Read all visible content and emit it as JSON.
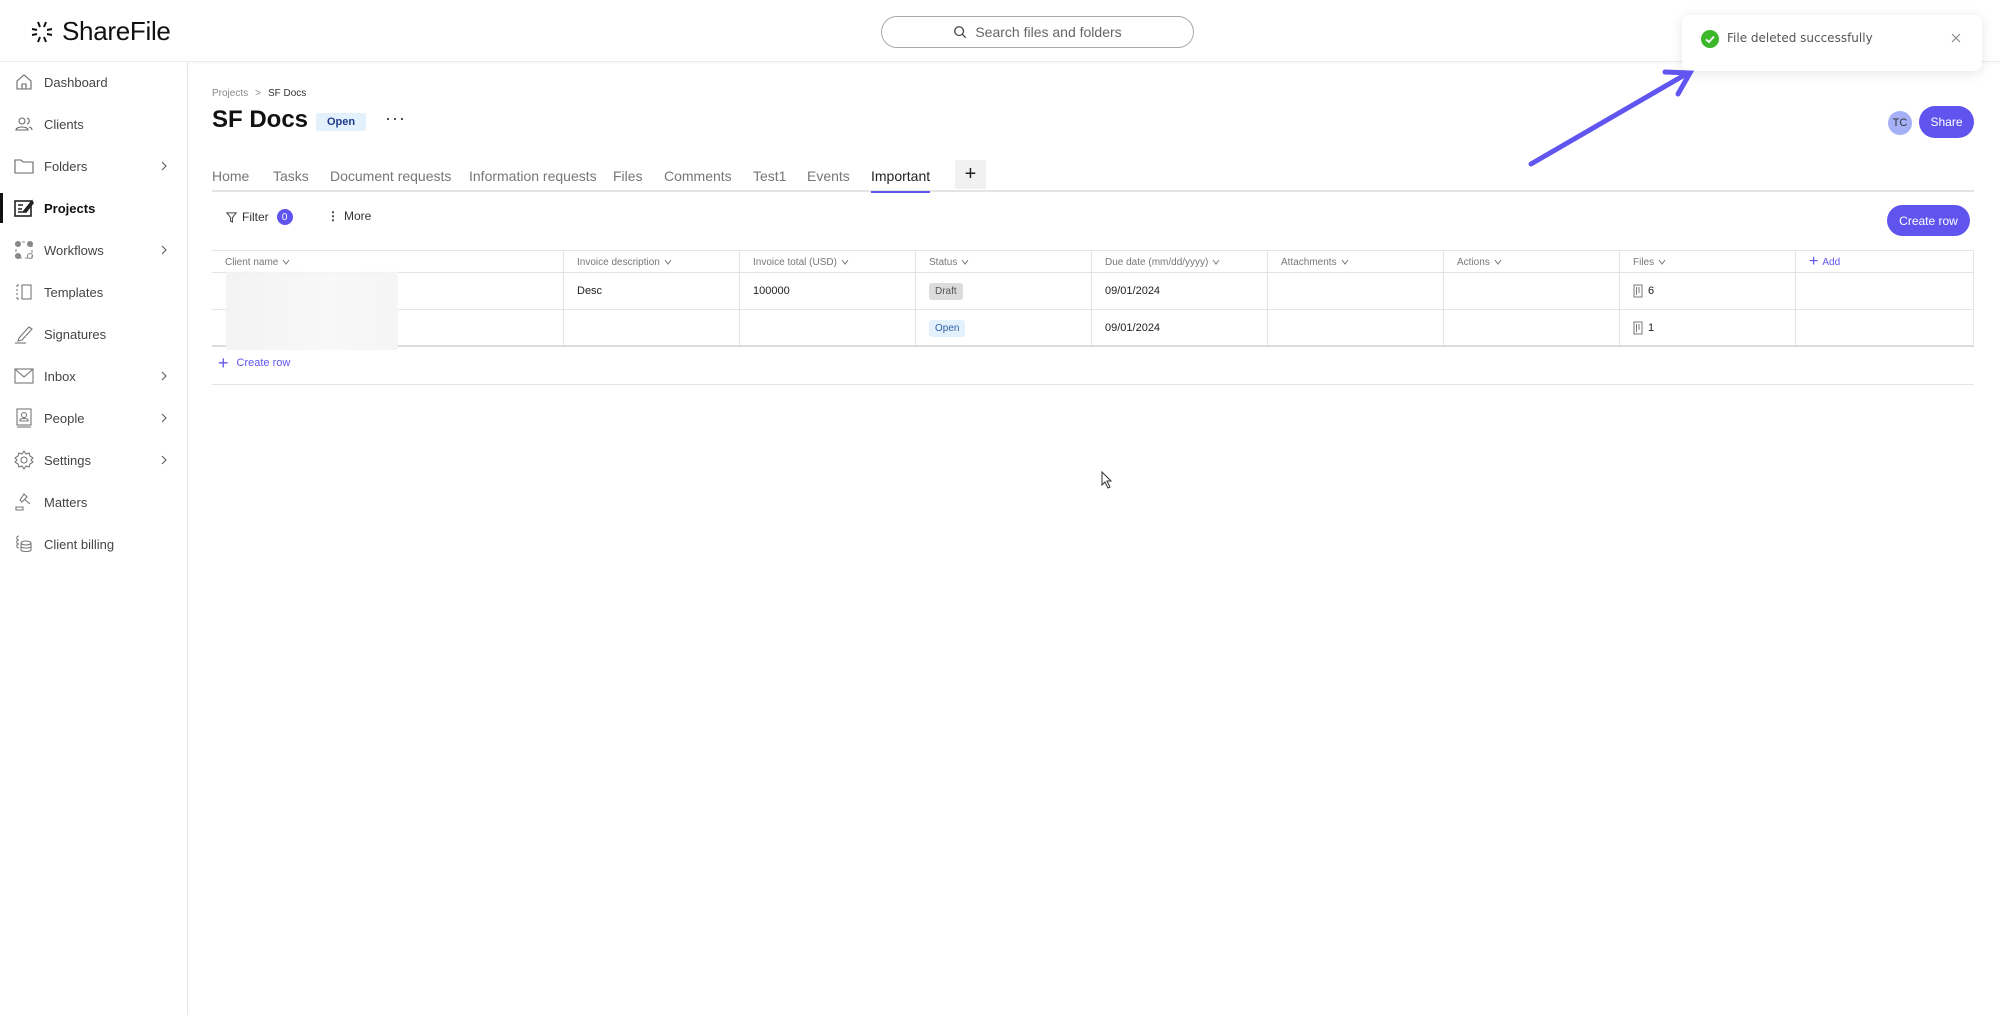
{
  "app": {
    "logo_text": "ShareFile"
  },
  "search": {
    "placeholder": "Search files and folders"
  },
  "sidebar": {
    "items": [
      {
        "label": "Dashboard",
        "icon": "home-icon",
        "has_chevron": false,
        "active": false
      },
      {
        "label": "Clients",
        "icon": "people-icon",
        "has_chevron": false,
        "active": false
      },
      {
        "label": "Folders",
        "icon": "folder-icon",
        "has_chevron": true,
        "active": false
      },
      {
        "label": "Projects",
        "icon": "projects-icon",
        "has_chevron": false,
        "active": true
      },
      {
        "label": "Workflows",
        "icon": "workflows-icon",
        "has_chevron": true,
        "active": false
      },
      {
        "label": "Templates",
        "icon": "templates-icon",
        "has_chevron": false,
        "active": false
      },
      {
        "label": "Signatures",
        "icon": "pen-icon",
        "has_chevron": false,
        "active": false
      },
      {
        "label": "Inbox",
        "icon": "mail-icon",
        "has_chevron": true,
        "active": false
      },
      {
        "label": "People",
        "icon": "contact-book-icon",
        "has_chevron": true,
        "active": false
      },
      {
        "label": "Settings",
        "icon": "gear-icon",
        "has_chevron": true,
        "active": false
      },
      {
        "label": "Matters",
        "icon": "gavel-icon",
        "has_chevron": false,
        "active": false
      },
      {
        "label": "Client billing",
        "icon": "billing-icon",
        "has_chevron": false,
        "active": false
      }
    ]
  },
  "breadcrumb": {
    "parent": "Projects",
    "separator": ">",
    "current": "SF Docs"
  },
  "page": {
    "title": "SF Docs",
    "status": "Open",
    "more_label": "···",
    "avatar_initials": "TC",
    "share_label": "Share"
  },
  "tabs": [
    {
      "label": "Home",
      "active": false
    },
    {
      "label": "Tasks",
      "active": false
    },
    {
      "label": "Document requests",
      "active": false
    },
    {
      "label": "Information requests",
      "active": false
    },
    {
      "label": "Files",
      "active": false
    },
    {
      "label": "Comments",
      "active": false
    },
    {
      "label": "Test1",
      "active": false
    },
    {
      "label": "Events",
      "active": false
    },
    {
      "label": "Important",
      "active": true
    }
  ],
  "tab_add_label": "+",
  "toolbar": {
    "filter_label": "Filter",
    "filter_count": "0",
    "more_label": "More",
    "create_row_label": "Create row"
  },
  "table": {
    "columns": [
      "Client name",
      "Invoice description",
      "Invoice total (USD)",
      "Status",
      "Due date (mm/dd/yyyy)",
      "Attachments",
      "Actions",
      "Files"
    ],
    "add_column_label": "Add",
    "rows": [
      {
        "client_name": "",
        "invoice_description": "Desc",
        "invoice_total": "100000",
        "status": "Draft",
        "due_date": "09/01/2024",
        "attachments": "",
        "actions": "",
        "files": "6"
      },
      {
        "client_name": "",
        "invoice_description": "",
        "invoice_total": "",
        "status": "Open",
        "due_date": "09/01/2024",
        "attachments": "",
        "actions": "",
        "files": "1"
      }
    ],
    "create_row_label": "Create row"
  },
  "toast": {
    "message": "File deleted successfully",
    "type": "success"
  },
  "colors": {
    "accent": "#5f55ee",
    "success": "#3cb72a",
    "open_badge_bg": "#e3f1fd",
    "draft_badge_bg": "#dcdcdc"
  }
}
